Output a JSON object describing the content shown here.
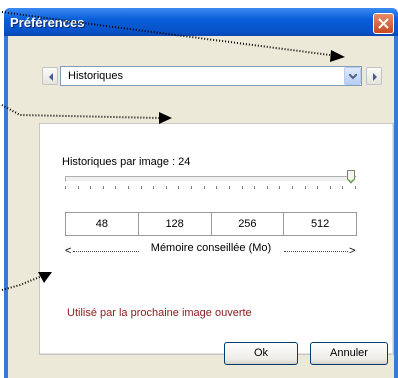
{
  "window": {
    "title": "Préférences"
  },
  "nav": {
    "prev_icon": "chevron-left-icon",
    "next_icon": "chevron-right-icon"
  },
  "combo": {
    "selected": "Historiques",
    "options": [
      "Historiques"
    ]
  },
  "history": {
    "label": "Historiques par image : 24",
    "slider_fraction": 0.98
  },
  "memory": {
    "values": [
      "48",
      "128",
      "256",
      "512"
    ],
    "label": "Mémoire conseillée (Mo)"
  },
  "note": "Utilisé par la prochaine image ouverte",
  "buttons": {
    "ok": "Ok",
    "cancel": "Annuler"
  },
  "colors": {
    "titlebar": "#0a5fd8",
    "note_text": "#8b1a1a",
    "close": "#c84a20"
  }
}
